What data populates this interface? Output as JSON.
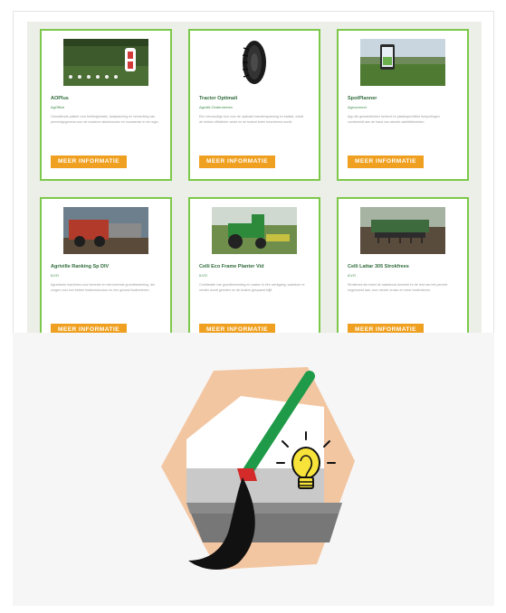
{
  "cards": [
    {
      "title": "AOPlus",
      "subtitle": "AgOffice",
      "description": "Omvattende pakket voor teeltregistratie, taakplanning en verwerking van perceelgegevens voor de moderne akkerbouwer en loonwerker in de regio.",
      "button_label": "MEER INFORMATIE"
    },
    {
      "title": "Tractor Optimali",
      "subtitle": "Agrotik Ondernemen",
      "description": "Een eenvoudige tool voor de optimale bandenspanning en ballast, zodat de trekker efficiënter werkt en de bodem beter beschermd wordt.",
      "button_label": "MEER INFORMATIE"
    },
    {
      "title": "SpotPlanner",
      "subtitle": "Agrocorrect",
      "description": "App die gewasvlekken herkent en plaatsspecifieke bespuitingen voorbereidt aan de hand van actuele satellietbeelden.",
      "button_label": "MEER INFORMATIE"
    },
    {
      "title": "Agriville Ranking Sp DIV",
      "subtitle": "ILVO",
      "description": "Agrarische machines voor kerende en niet-kerende grondbewerking, die zorgen voor een betere bodemstructuur en een gezond bodemleven.",
      "button_label": "MEER INFORMATIE"
    },
    {
      "title": "Celli Eco Frame Planter Vid",
      "subtitle": "ILVO",
      "description": "Combinatie van grondbewerking en zaaien in één werkgang, waardoor er minder wordt gereden en de bodem gespaard blijft.",
      "button_label": "MEER INFORMATIE"
    },
    {
      "title": "Celli Lattar 305 Strokfrees",
      "subtitle": "ILVO",
      "description": "Strokfrees die enkel de zaaistrook bewerkt en de rest van het perceel ongemoeid laat, voor minder erosie en meer bodemleven.",
      "button_label": "MEER INFORMATIE"
    }
  ],
  "colors": {
    "card_border": "#7cc84a",
    "button": "#f0a020",
    "title": "#2f6b3a",
    "logo_hexagon": "#f3c6a2",
    "logo_handle": "#1e9a48",
    "logo_blade": "#111111",
    "logo_bulb": "#f7e33a"
  },
  "icons": {
    "logo": "spade-and-lightbulb-logo"
  }
}
